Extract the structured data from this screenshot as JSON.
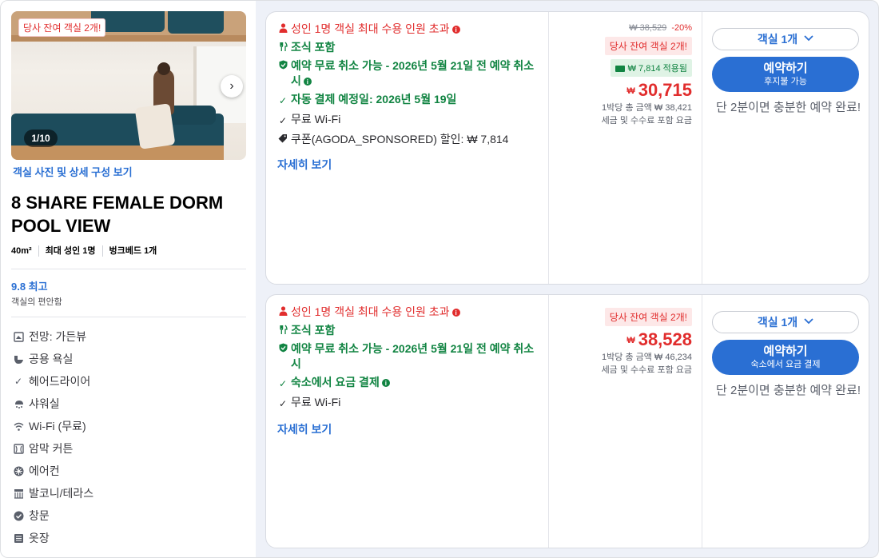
{
  "left": {
    "photo_badge": "당사 잔여 객실 2개!",
    "photo_counter": "1/10",
    "photo_link": "객실 사진 및 상세 구성 보기",
    "room_title": "8 SHARE FEMALE DORM POOL VIEW",
    "specs": [
      "40m²",
      "최대 성인 1명",
      "벙크베드 1개"
    ],
    "score": "9.8 최고",
    "score_sub": "객실의 편안함",
    "amenities": [
      {
        "icon": "garden-view-icon",
        "label": "전망: 가든뷰"
      },
      {
        "icon": "toilet-icon",
        "label": "공용 욕실"
      },
      {
        "icon": "check-icon",
        "label": "헤어드라이어"
      },
      {
        "icon": "shower-icon",
        "label": "샤워실"
      },
      {
        "icon": "wifi-icon",
        "label": "Wi-Fi (무료)"
      },
      {
        "icon": "curtain-icon",
        "label": "암막 커튼"
      },
      {
        "icon": "air-conditioner-icon",
        "label": "에어컨"
      },
      {
        "icon": "balcony-icon",
        "label": "발코니/테라스"
      },
      {
        "icon": "window-icon",
        "label": "창문"
      },
      {
        "icon": "closet-icon",
        "label": "옷장"
      }
    ]
  },
  "offers": [
    {
      "warning": "성인 1명 객실 최대 수용 인원 초과",
      "breakfast": "조식 포함",
      "cancel": "예약 무료 취소 가능 - 2026년 5월 21일 전 예약 취소 시",
      "payment": "자동 결제 예정일: 2026년 5월 19일",
      "wifi": "무료 Wi-Fi",
      "coupon": "쿠폰(AGODA_SPONSORED) 할인: ₩ 7,814",
      "more": "자세히 보기",
      "original_price": "₩ 38,529",
      "discount": "-20%",
      "remaining": "당사 잔여 객실 2개!",
      "coupon_applied": "₩ 7,814 적용됨",
      "currency": "₩",
      "price": "30,715",
      "total": "1박당 총 금액 ₩ 38,421",
      "tax_note": "세금 및 수수료 포함 요금",
      "room_count": "객실 1개",
      "book_label": "예약하기",
      "book_sub": "후지불 가능",
      "hint": "단 2분이면 충분한 예약 완료!"
    },
    {
      "warning": "성인 1명 객실 최대 수용 인원 초과",
      "breakfast": "조식 포함",
      "cancel": "예약 무료 취소 가능 - 2026년 5월 21일 전 예약 취소 시",
      "payment": "숙소에서 요금 결제",
      "wifi": "무료 Wi-Fi",
      "more": "자세히 보기",
      "remaining": "당사 잔여 객실 2개!",
      "currency": "₩",
      "price": "38,528",
      "total": "1박당 총 금액 ₩ 46,234",
      "tax_note": "세금 및 수수료 포함 요금",
      "room_count": "객실 1개",
      "book_label": "예약하기",
      "book_sub": "숙소에서 요금 결제",
      "hint": "단 2분이면 충분한 예약 완료!"
    }
  ],
  "colors": {
    "accent": "#2a6fd3",
    "danger": "#e12d2d",
    "success": "#118442"
  }
}
